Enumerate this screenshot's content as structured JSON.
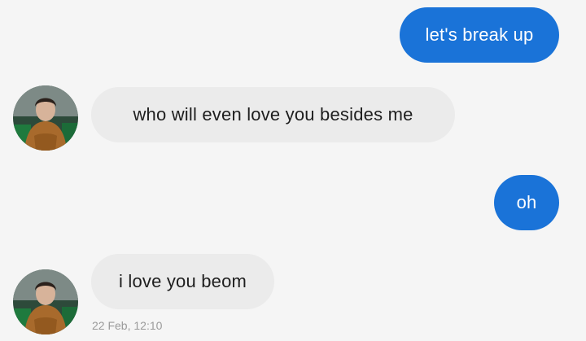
{
  "messages": [
    {
      "direction": "outgoing",
      "text": "let's break up"
    },
    {
      "direction": "incoming",
      "text": "who will even love you besides me",
      "avatar_icon": "contact-avatar-icon"
    },
    {
      "direction": "outgoing",
      "text": "oh"
    },
    {
      "direction": "incoming",
      "text": "i love you beom",
      "avatar_icon": "contact-avatar-icon"
    }
  ],
  "timestamp": "22 Feb, 12:10",
  "colors": {
    "background": "#f5f5f5",
    "outgoing_bubble": "#1a73d8",
    "incoming_bubble": "#ebebeb",
    "timestamp_text": "#9a9a9a"
  }
}
